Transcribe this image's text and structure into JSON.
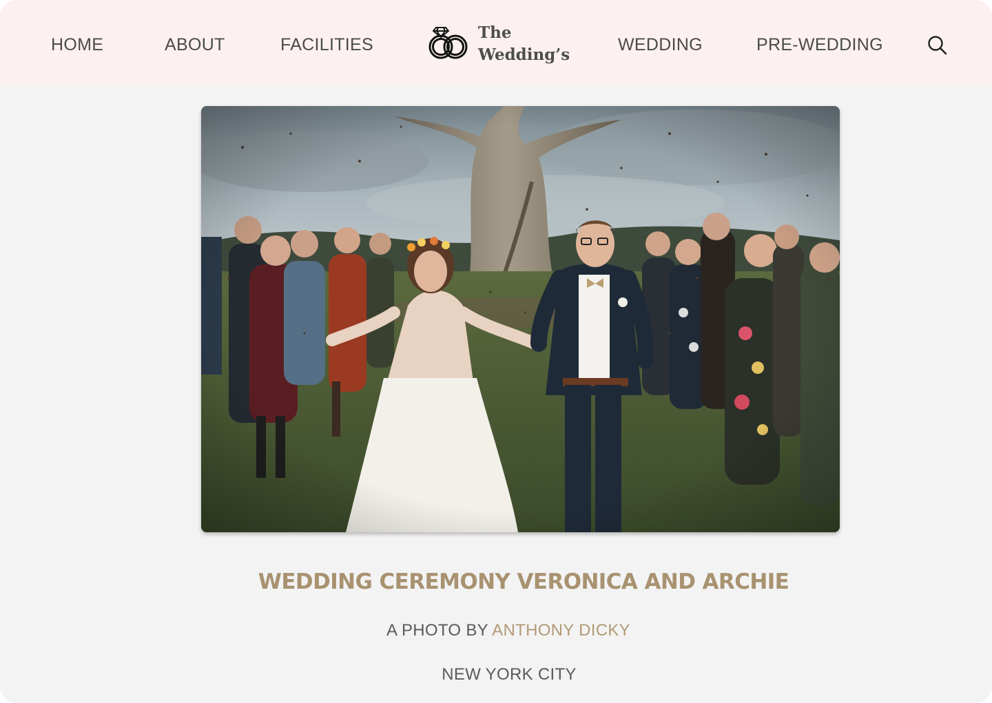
{
  "nav": {
    "links": [
      "HOME",
      "ABOUT",
      "FACILITIES",
      "WEDDING",
      "PRE-WEDDING"
    ],
    "brand": {
      "line1": "The",
      "line2": "Wedding’s"
    },
    "search_icon": "search-icon"
  },
  "hero": {
    "icon": "wedding-photo"
  },
  "caption": {
    "title": "WEDDING CEREMONY VERONICA AND ARCHIE",
    "credit_prefix": "A PHOTO BY",
    "photographer": "ANTHONY DICKY",
    "location": "NEW YORK CITY"
  },
  "colors": {
    "nav_background": "#fcf1f0",
    "page_background": "#f3f3f3",
    "accent_gold": "#a89270",
    "text_gray": "#4a4a4a"
  }
}
